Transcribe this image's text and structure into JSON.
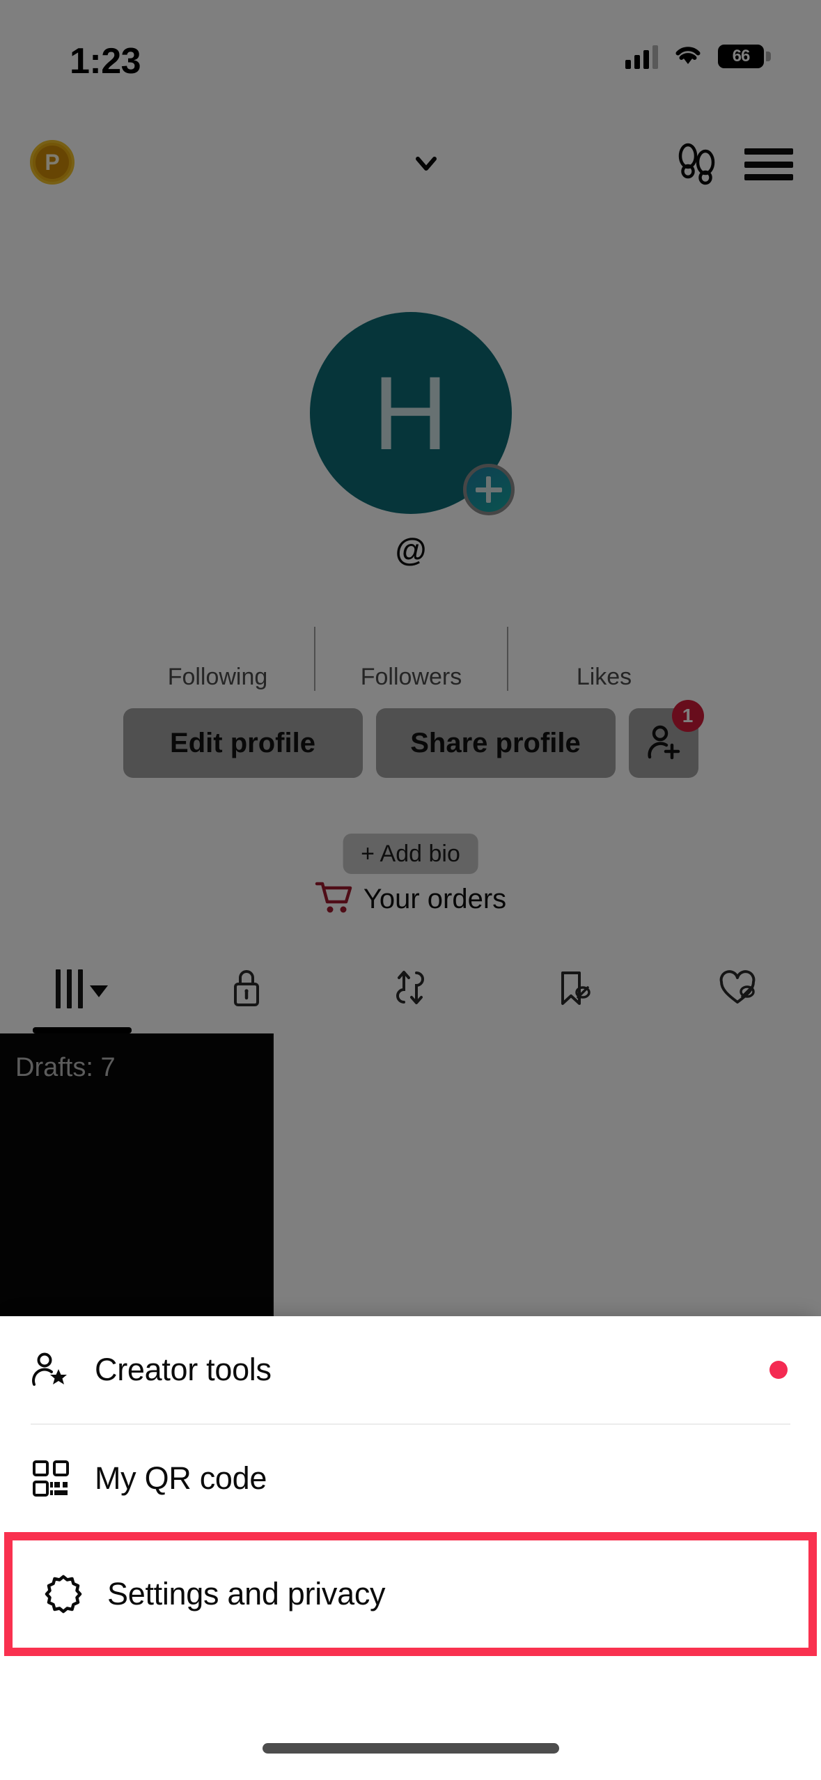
{
  "status_bar": {
    "time": "1:23",
    "battery_level": "66",
    "signal_icon": "cellular-signal-icon",
    "wifi_icon": "wifi-icon",
    "battery_icon": "battery-icon"
  },
  "top_nav": {
    "coin_badge_letter": "P",
    "coin_badge_name": "rewards-coin-badge",
    "chevron_icon": "chevron-down-icon",
    "footprints_icon": "footprints-icon",
    "menu_icon": "hamburger-menu-icon"
  },
  "profile": {
    "avatar_initial": "H",
    "avatar_color": "#0c6b74",
    "add_story_icon": "plus-icon",
    "handle": "@",
    "stats": [
      {
        "label": "Following",
        "count": ""
      },
      {
        "label": "Followers",
        "count": ""
      },
      {
        "label": "Likes",
        "count": ""
      }
    ],
    "edit_profile_label": "Edit profile",
    "share_profile_label": "Share profile",
    "add_friends_icon": "add-user-icon",
    "add_friends_badge": "1",
    "add_bio_label": "+ Add bio",
    "your_orders_label": "Your orders",
    "your_orders_icon": "shopping-cart-icon",
    "cart_color": "#9e1b2f"
  },
  "tabs": [
    {
      "name": "tab-videos",
      "icon": "grid-icon",
      "active": true,
      "has_caret": true
    },
    {
      "name": "tab-private",
      "icon": "lock-icon",
      "active": false,
      "has_caret": false
    },
    {
      "name": "tab-reposts",
      "icon": "repost-icon",
      "active": false,
      "has_caret": false
    },
    {
      "name": "tab-saved",
      "icon": "bookmark-hidden-icon",
      "active": false,
      "has_caret": false
    },
    {
      "name": "tab-liked",
      "icon": "heart-hidden-icon",
      "active": false,
      "has_caret": false
    }
  ],
  "content": {
    "drafts_label": "Drafts: 7"
  },
  "sheet": {
    "items": [
      {
        "label": "Creator tools",
        "icon": "person-star-icon",
        "has_dot": true,
        "highlighted": false
      },
      {
        "label": "My QR code",
        "icon": "qr-code-icon",
        "has_dot": false,
        "highlighted": false
      },
      {
        "label": "Settings and privacy",
        "icon": "gear-icon",
        "has_dot": false,
        "highlighted": true
      }
    ],
    "highlight_color": "#f9314f",
    "dot_color": "#f42a52"
  }
}
